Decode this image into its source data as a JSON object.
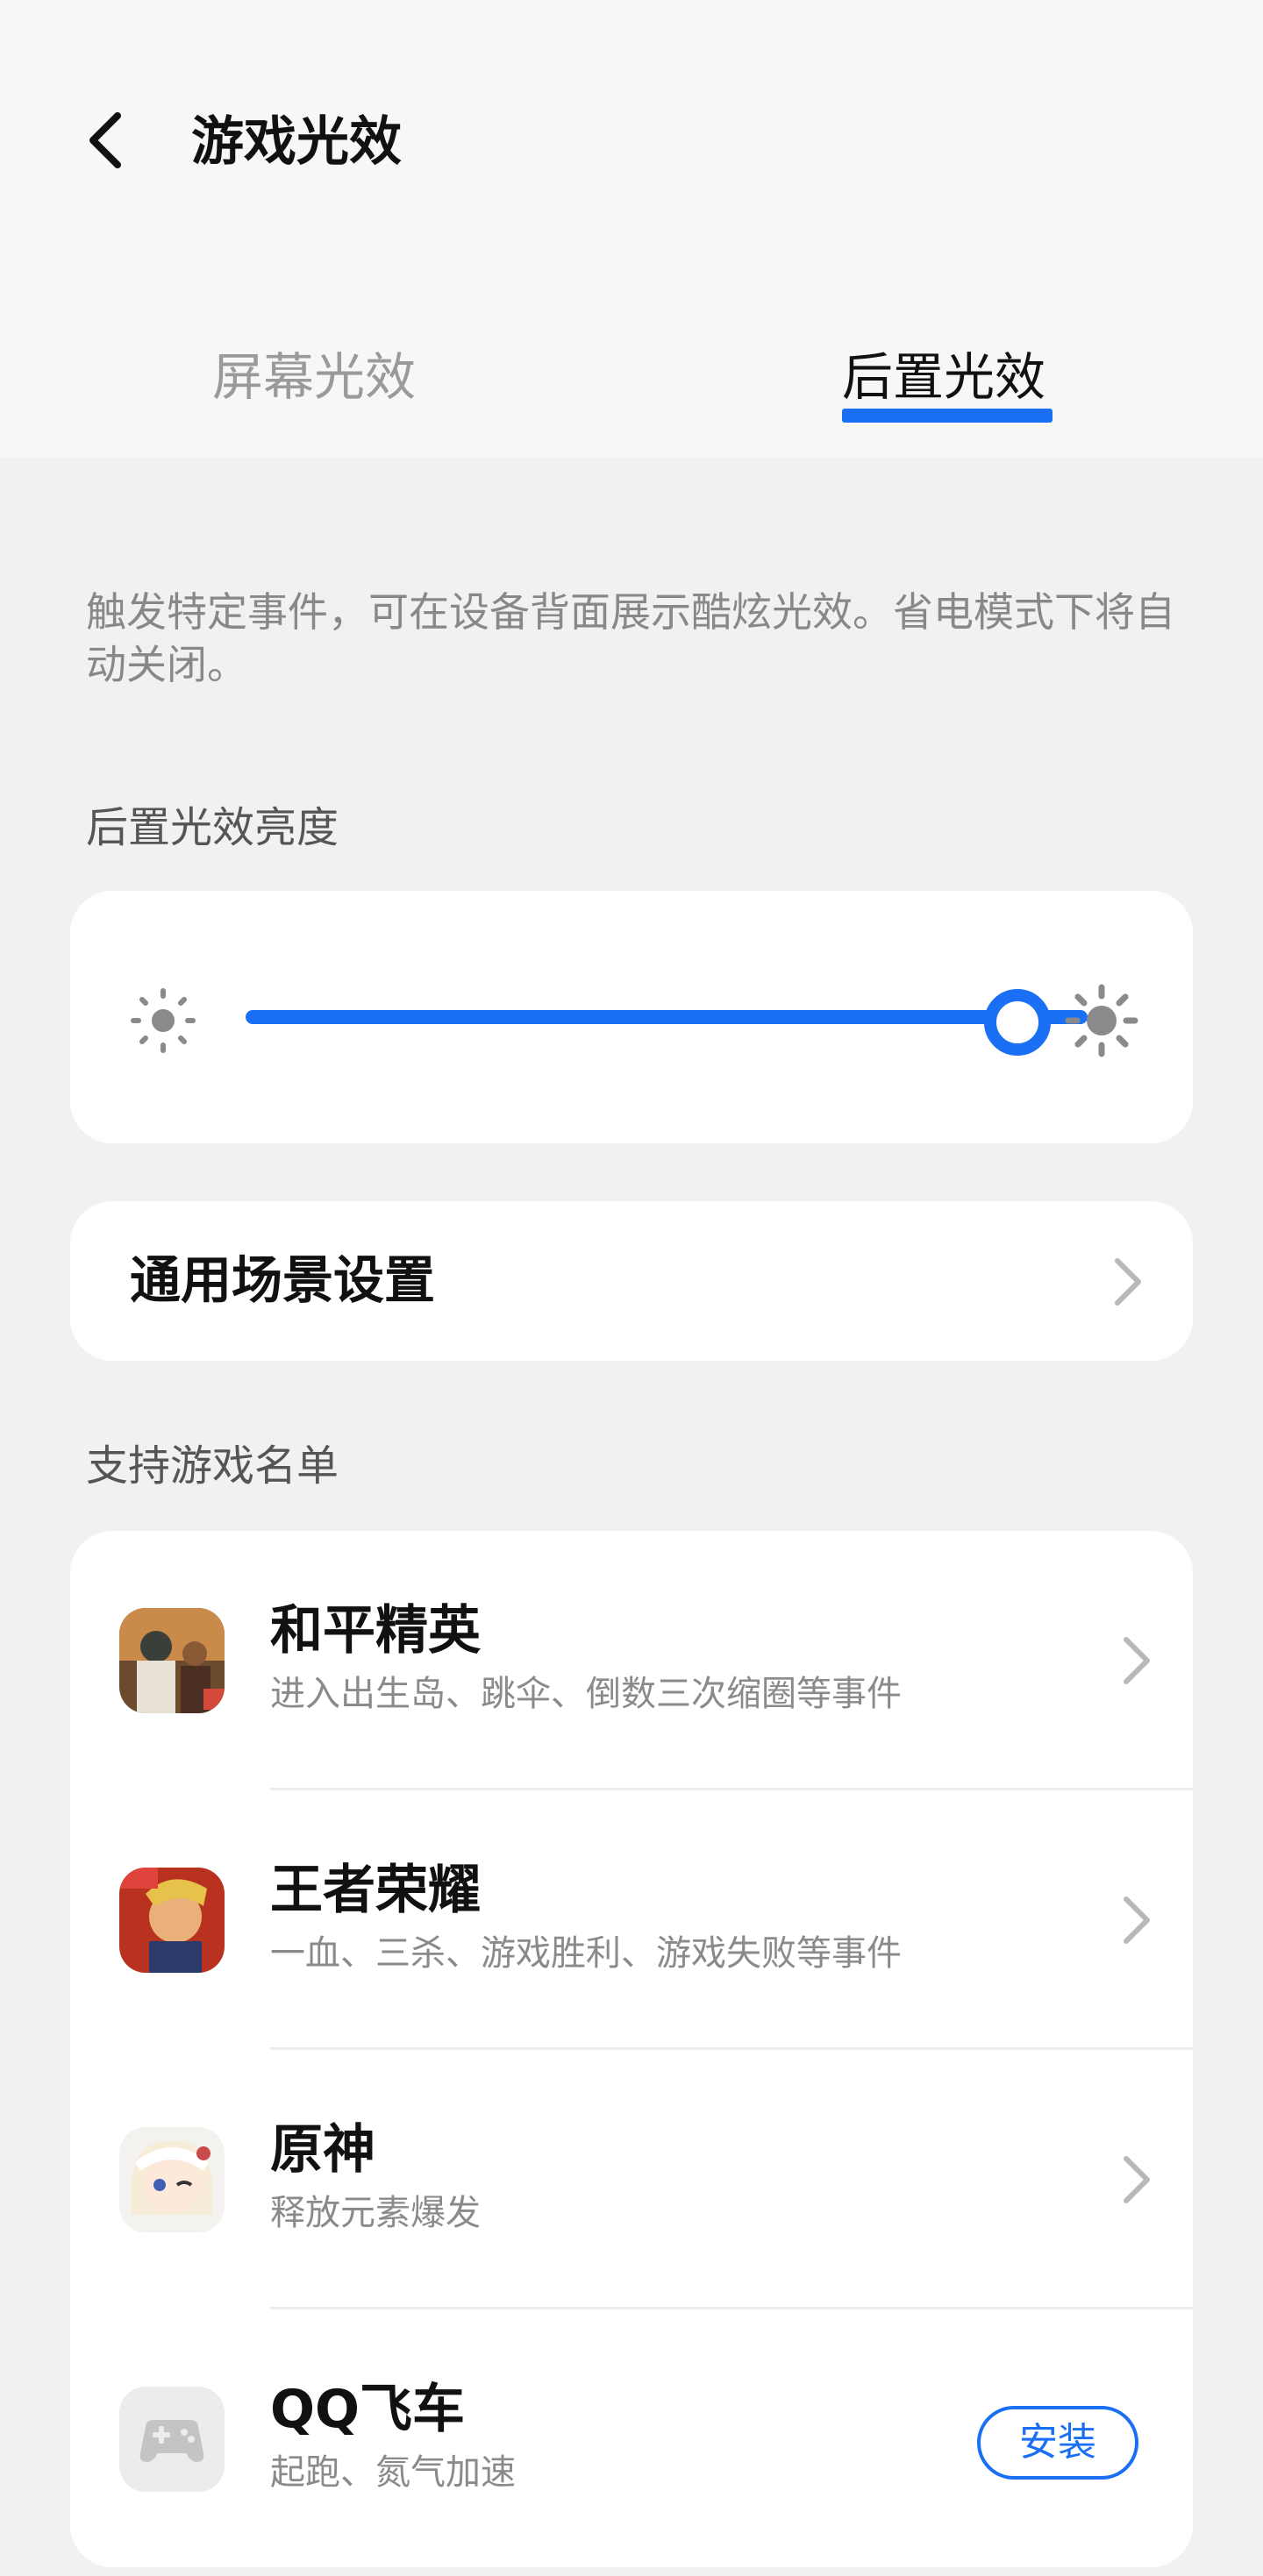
{
  "header": {
    "title": "游戏光效",
    "tabs": [
      {
        "label": "屏幕光效",
        "active": false
      },
      {
        "label": "后置光效",
        "active": true
      }
    ]
  },
  "description": "触发特定事件，可在设备背面展示酷炫光效。省电模式下将自动关闭。",
  "brightness": {
    "section_label": "后置光效亮度",
    "level_percent": 100,
    "min_icon": "sun-small-icon",
    "max_icon": "sun-large-icon"
  },
  "scene": {
    "label": "通用场景设置"
  },
  "games": {
    "section_label": "支持游戏名单",
    "items": [
      {
        "name": "和平精英",
        "desc": "进入出生岛、跳伞、倒数三次缩圈等事件",
        "action": "chevron"
      },
      {
        "name": "王者荣耀",
        "desc": "一血、三杀、游戏胜利、游戏失败等事件",
        "action": "chevron"
      },
      {
        "name": "原神",
        "desc": "释放元素爆发",
        "action": "chevron"
      },
      {
        "name": "QQ飞车",
        "desc": "起跑、氮气加速",
        "action": "install",
        "action_label": "安装"
      }
    ]
  },
  "colors": {
    "accent": "#1a6ff5",
    "background": "#f1f1f3",
    "card": "#ffffff"
  }
}
